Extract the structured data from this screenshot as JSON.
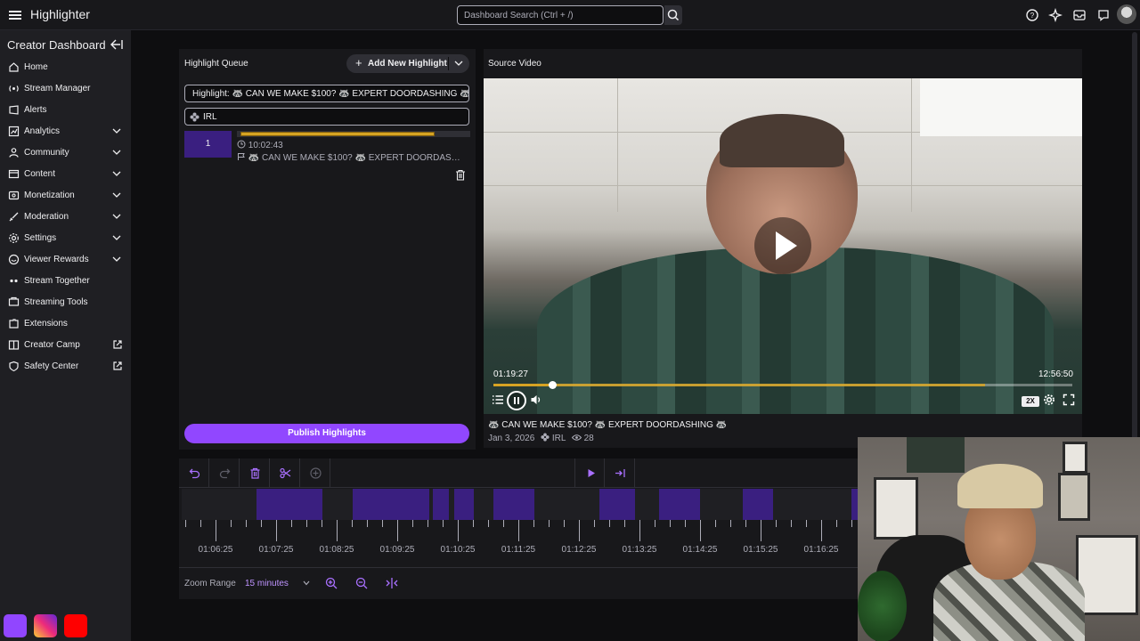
{
  "app": {
    "title": "Highlighter"
  },
  "search": {
    "placeholder": "Dashboard Search (Ctrl + /)"
  },
  "sidebar": {
    "title": "Creator Dashboard",
    "items": [
      {
        "label": "Home",
        "icon": "home-icon"
      },
      {
        "label": "Stream Manager",
        "icon": "stream-manager-icon"
      },
      {
        "label": "Alerts",
        "icon": "bell-icon"
      },
      {
        "label": "Analytics",
        "icon": "analytics-icon"
      },
      {
        "label": "Community",
        "icon": "community-icon"
      },
      {
        "label": "Content",
        "icon": "content-icon"
      },
      {
        "label": "Monetization",
        "icon": "monetization-icon"
      },
      {
        "label": "Moderation",
        "icon": "sword-icon"
      },
      {
        "label": "Settings",
        "icon": "gear-icon"
      },
      {
        "label": "Viewer Rewards",
        "icon": "rewards-icon"
      },
      {
        "label": "Stream Together",
        "icon": "stream-together-icon"
      },
      {
        "label": "Streaming Tools",
        "icon": "tools-icon"
      },
      {
        "label": "Extensions",
        "icon": "extensions-icon"
      },
      {
        "label": "Creator Camp",
        "icon": "camp-icon"
      },
      {
        "label": "Safety Center",
        "icon": "shield-icon"
      }
    ]
  },
  "queue": {
    "title": "Highlight Queue",
    "add_label": "Add New Highlight",
    "title_field": "Highlight: 🦝 CAN WE MAKE $100? 🦝 EXPERT DOORDASHING 🦝",
    "category_field": "IRL",
    "clip": {
      "number": "1",
      "duration": "10:02:43",
      "description": "🦝 CAN WE MAKE $100? 🦝 EXPERT DOORDASHIN..."
    },
    "publish_label": "Publish Highlights"
  },
  "video": {
    "panel_title": "Source Video",
    "current_time": "01:19:27",
    "total_time": "12:56:50",
    "progress": 0.102,
    "speed": "2X",
    "title": "🦝 CAN WE MAKE $100? 🦝 EXPERT DOORDASHING 🦝",
    "date": "Jan 3, 2026",
    "category": "IRL",
    "views": "28"
  },
  "timeline": {
    "ticks": [
      "01:06:25",
      "01:07:25",
      "01:08:25",
      "01:09:25",
      "01:10:25",
      "01:11:25",
      "01:12:25",
      "01:13:25",
      "01:14:25",
      "01:15:25",
      "01:16:25"
    ],
    "zoom_label": "Zoom Range",
    "zoom_value": "15 minutes"
  },
  "colors": {
    "accent": "#9147ff",
    "highlight": "#d6a323",
    "segment": "#3a1f80"
  }
}
